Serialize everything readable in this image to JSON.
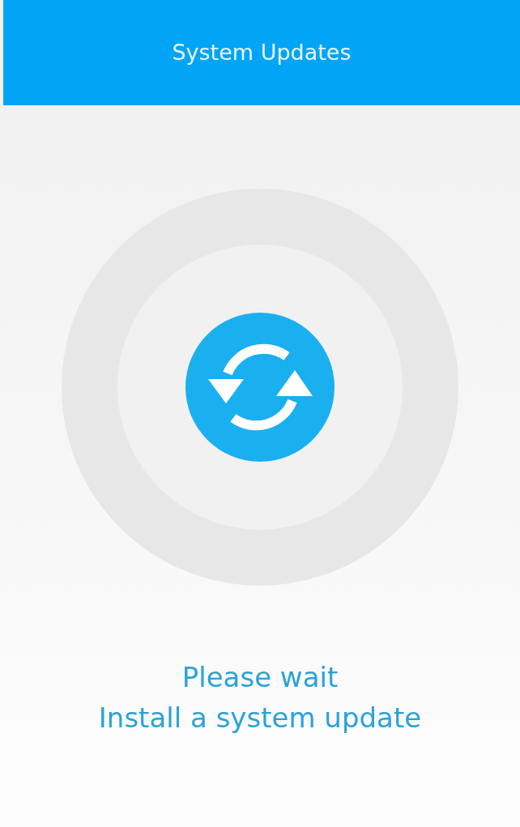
{
  "header": {
    "title": "System Updates"
  },
  "status": {
    "lines": [
      "Please wait",
      "Install a system update"
    ]
  }
}
